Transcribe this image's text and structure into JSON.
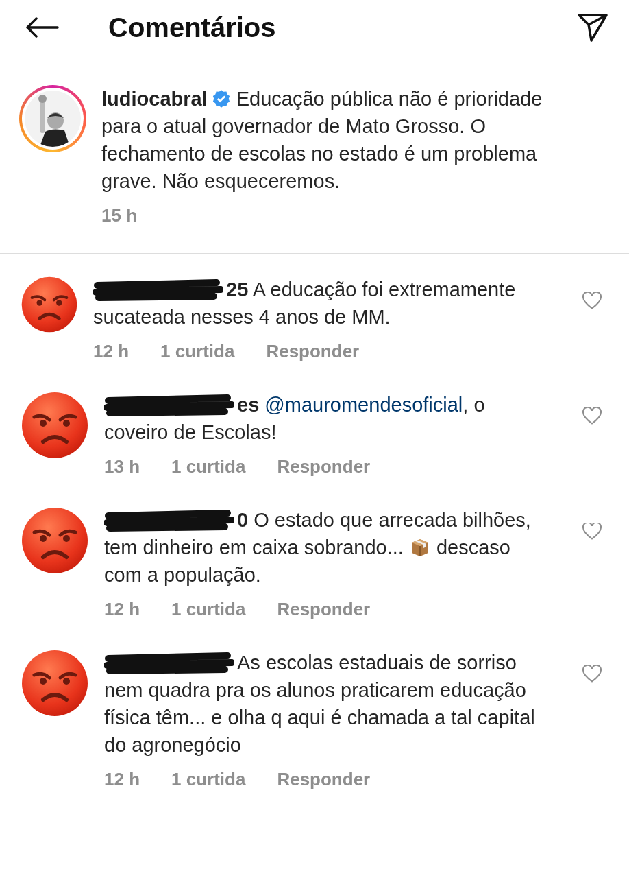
{
  "header": {
    "title": "Comentários"
  },
  "caption": {
    "username": "ludiocabral",
    "verified": true,
    "text": "Educação pública não é prioridade para o atual governador de Mato Grosso. O fechamento de escolas no estado é um problema grave. Não esqueceremos.",
    "time": "15 h"
  },
  "comments": [
    {
      "redacted": true,
      "username": "25",
      "parts": [
        {
          "kind": "text",
          "text": "A educação foi extremamente sucateada nesses 4 anos de MM."
        }
      ],
      "time": "12 h",
      "likes": "1 curtida",
      "reply": "Responder",
      "liked": false
    },
    {
      "redacted": true,
      "username": "es",
      "parts": [
        {
          "kind": "mention",
          "text": "@mauromendesoficial"
        },
        {
          "kind": "text",
          "text": ", o coveiro de Escolas!"
        }
      ],
      "time": "13 h",
      "likes": "1 curtida",
      "reply": "Responder",
      "liked": false
    },
    {
      "redacted": true,
      "username": "0",
      "parts": [
        {
          "kind": "text",
          "text": "O estado que arrecada bilhões, tem dinheiro em caixa sobrando... "
        },
        {
          "kind": "box"
        },
        {
          "kind": "text",
          "text": " descaso com a população."
        }
      ],
      "time": "12 h",
      "likes": "1 curtida",
      "reply": "Responder",
      "liked": false
    },
    {
      "redacted": true,
      "parts": [
        {
          "kind": "text",
          "text": "As escolas estaduais de sorriso nem quadra pra os alunos praticarem educação física têm... e olha q aqui é chamada a tal capital do agronegócio"
        }
      ],
      "time": "12 h",
      "likes": "1 curtida",
      "reply": "Responder",
      "liked": false
    }
  ]
}
